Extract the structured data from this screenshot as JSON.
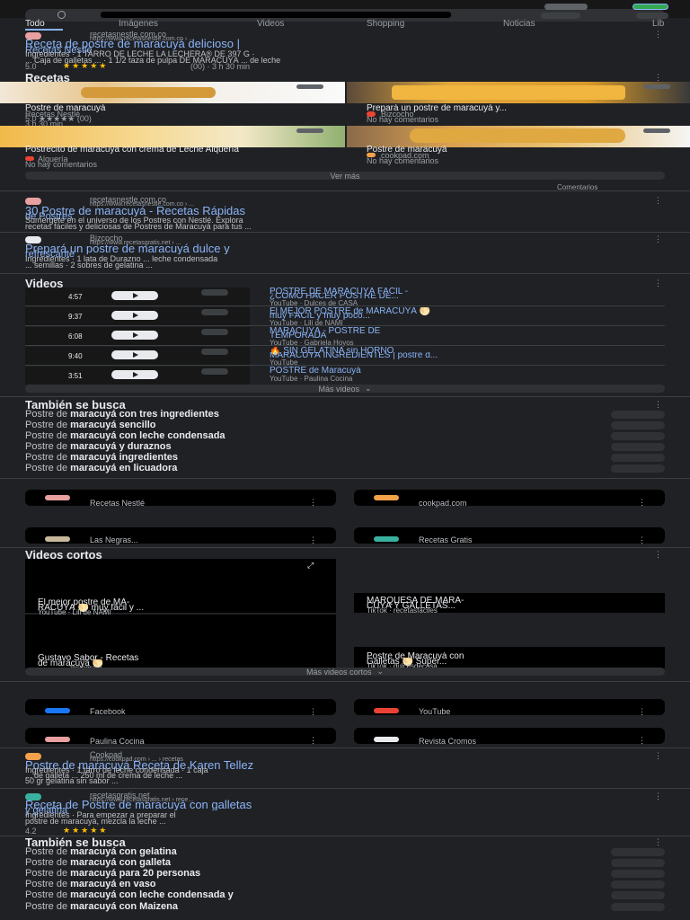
{
  "search": {
    "placeholder": ""
  },
  "tabs": [
    "Todo",
    "Imágenes",
    "Videos",
    "Shopping",
    "Noticias",
    "Lib"
  ],
  "results": [
    {
      "site": "recetasnestle.com.co",
      "url": "https://www.recetasnestle.com.co › ...",
      "title": "Receta de postre de maracuyá delicioso |",
      "subtitle": "Recetas Nestlé",
      "snippet1": "Ingredientes · 1 TARRO DE LECHE LA LECHERA® DE 397 G ·",
      "snippet2": "... Caja de galletas ... · 1 1/2 taza de pulpa DE MARACUYÁ ... de leche",
      "rating": "5.0",
      "stars": "★★★★★",
      "rating_meta": "(00) · 3 h 30 min"
    },
    {
      "site": "recetasnestle.com.co",
      "url": "https://www.recetasnestle.com.co › ...",
      "title": "30 Postre de maracuyá - Recetas Rápidas",
      "subtitle": "de Postres",
      "snippet1": "Sumérgete en el universo de los Postres con Nestlé. Explora",
      "snippet2": "recetas fáciles y deliciosas de Postres de Maracuyá para tus ..."
    },
    {
      "site": "Bizcocho",
      "url": "https://www.recetasgratis.net › ...",
      "title": "Prepará un postre de maracuyá dulce y",
      "subtitle": "refrescante",
      "snippet1": "Ingredientes · 1 lata de Durazno ... leche condensada",
      "snippet2": "... semillas · 2 sobres de gelatina ..."
    },
    {
      "site": "Cookpad",
      "url": "https://cookpad.com › ... › recetas",
      "title": "Postre de maracuyá Receta de Karen Tellez",
      "snippet1": "Ingredientes · 1 tarro de leche condensada · 1 caja",
      "snippet2": "... de galleta ... 250 ml de crema de leche ...",
      "snippet3": "50 gr gelatina sin sabor ..."
    },
    {
      "site": "recetasgratis.net",
      "url": "https://www.recetasgratis.net › rece...",
      "title": "Receta de Postre de maracuyá con galletas",
      "subtitle": "y gelatina",
      "snippet1": "Ingredientes · Para empezar a preparar el",
      "snippet2": "postre de maracuyá, mezcla la leche ...",
      "rating": "4.2",
      "stars": "★★★★★"
    }
  ],
  "recipes": {
    "heading": "Recetas",
    "items": [
      {
        "title": "Postre de maracuyá",
        "site": "Recetas Nestlé",
        "meta": "5.0 ★★★★★ (00)",
        "time": "3 h 30 min"
      },
      {
        "title": "Prepará un postre de maracuyá y...",
        "site": "Bizcocho",
        "meta": "No hay comentarios"
      },
      {
        "title": "Postrecito de maracuyá con crema de Leche Alquería",
        "site": "Alquería",
        "meta": "No hay comentarios"
      },
      {
        "title": "Postre de maracuyá",
        "site": "cookpad.com",
        "meta": "No hay comentarios"
      }
    ],
    "more": "Ver más",
    "feedback": "Comentarios"
  },
  "videos": {
    "heading": "Videos",
    "items": [
      {
        "duration": "4:57",
        "title": "POSTRE DE MARACUYÁ FÁCIL -",
        "title2": "¿CÓMO HACER POSTRE DE...",
        "meta": "YouTube · Dulces de CASA"
      },
      {
        "duration": "9:37",
        "title": "El MEJOR POSTRE de MARACUYÁ 🌕",
        "title2": "muy FÁCIL y muy poco...",
        "meta": "YouTube · Lili de NAMI"
      },
      {
        "duration": "6:08",
        "title": "MARACUYÁ - POSTRE DE",
        "title2": "TEMPORADA",
        "meta": "YouTube · Gabriela Hoyos"
      },
      {
        "duration": "9:40",
        "title": "🔥 SIN GELATINA sin HORNO",
        "title2": "MARACUYÁ INGREDIENTES | postre d...",
        "meta": "YouTube"
      },
      {
        "duration": "3:51",
        "title": "POSTRE de Maracuyá",
        "title2": "",
        "meta": "YouTube · Paulina Cocina"
      }
    ],
    "more": "Más videos"
  },
  "related1": {
    "heading": "También se busca",
    "items": [
      {
        "pre": "Postre de ",
        "bold": "maracuyá con tres ingredientes"
      },
      {
        "pre": "Postre de ",
        "bold": "maracuyá sencillo"
      },
      {
        "pre": "Postre de ",
        "bold": "maracuyá con leche condensada"
      },
      {
        "pre": "Postre de ",
        "bold": "maracuyá y duraznos"
      },
      {
        "pre": "Postre de ",
        "bold": "maracuyá ingredientes"
      },
      {
        "pre": "Postre de ",
        "bold": "maracuyá en licuadora"
      }
    ]
  },
  "sources1": [
    {
      "label": "Recetas Nestlé"
    },
    {
      "label": "cookpad.com"
    },
    {
      "label": "Las Negras..."
    },
    {
      "label": "Recetas Gratis"
    }
  ],
  "shorts": {
    "heading": "Videos cortos",
    "items": [
      {
        "title": "El mejor postre de MA-",
        "title2": "RACUYÁ 🌕 muy fácil y ...",
        "meta": "YouTube · Lili de NAMI"
      },
      {
        "title": "MARQUESA DE MARA-",
        "title2": "CUYÁ Y GALLETAS...",
        "meta": "TikTok · recetasfaciles"
      },
      {
        "title": "Gustavo Sabor - Recetas",
        "title2": "de maracuyá 🌕",
        "meta": "Instagram"
      },
      {
        "title": "Postre de Maracuyá con",
        "title2": "Galletas 🌕 Super...",
        "meta": "TikTok · dulcesdecasa"
      }
    ],
    "more": "Más videos cortos"
  },
  "sources2": [
    {
      "label": "Facebook"
    },
    {
      "label": "YouTube"
    },
    {
      "label": "Paulina Cocina"
    },
    {
      "label": "Revista Cromos"
    }
  ],
  "related2": {
    "heading": "También se busca",
    "items": [
      {
        "pre": "Postre de ",
        "bold": "maracuyá con gelatina"
      },
      {
        "pre": "Postre de ",
        "bold": "maracuyá con galleta"
      },
      {
        "pre": "Postre de ",
        "bold": "maracuyá para 20 personas"
      },
      {
        "pre": "Postre de ",
        "bold": "maracuyá en vaso"
      },
      {
        "pre": "Postre de ",
        "bold": "maracuyá con leche condensada y"
      },
      {
        "pre": "Postre de ",
        "bold": "maracuyá con Maizena"
      }
    ]
  },
  "colors": {
    "bg": "#202124",
    "link": "#8ab4f8",
    "text": "#bdc1c6",
    "star": "#fbbc04"
  }
}
